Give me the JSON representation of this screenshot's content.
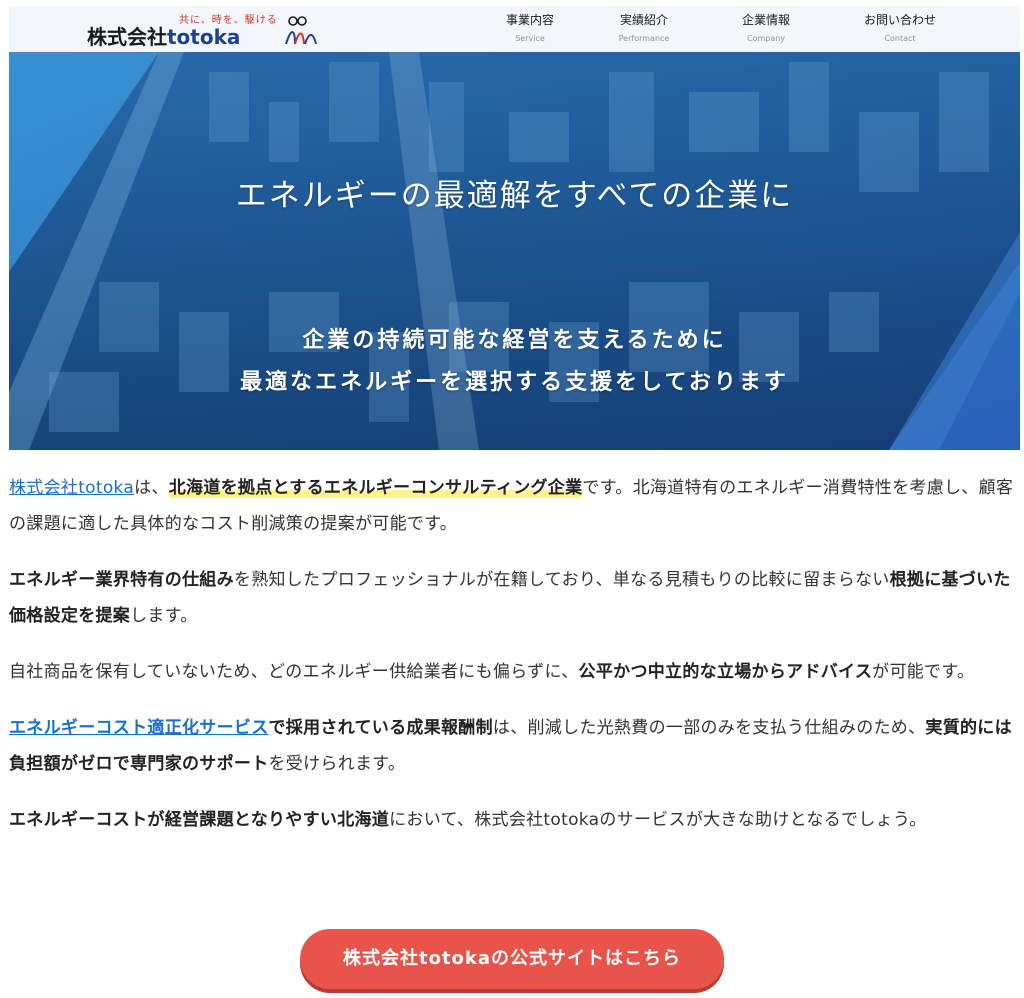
{
  "header": {
    "logo_tagline": "共に、時を、駆ける",
    "logo_name_jp": "株式会社",
    "logo_name_latin": "totoka",
    "nav": [
      {
        "label": "事業内容",
        "sub": "Service"
      },
      {
        "label": "実績紹介",
        "sub": "Performance"
      },
      {
        "label": "企業情報",
        "sub": "Company"
      },
      {
        "label": "お問い合わせ",
        "sub": "Contact"
      }
    ]
  },
  "hero": {
    "title": "エネルギーの最適解をすべての企業に",
    "sub_line1": "企業の持続可能な経営を支えるために",
    "sub_line2": "最適なエネルギーを選択する支援をしております"
  },
  "body": {
    "p1": {
      "link": "株式会社totoka",
      "t1": "は、",
      "highlight": "北海道を拠点とするエネルギーコンサルティング企業",
      "t2": "です。北海道特有のエネルギー消費特性を考慮し、顧客の課題に適した具体的なコスト削減策の提案が可能です。"
    },
    "p2": {
      "b1": "エネルギー業界特有の仕組み",
      "t1": "を熟知したプロフェッショナルが在籍しており、単なる見積もりの比較に留まらない",
      "b2": "根拠に基づいた価格設定を提案",
      "t2": "します。"
    },
    "p3": {
      "t1": "自社商品を保有していないため、どのエネルギー供給業者にも偏らずに、",
      "b1": "公平かつ中立的な立場からアドバイス",
      "t2": "が可能です。"
    },
    "p4": {
      "link": "エネルギーコスト適正化サービス",
      "b1": "で採用されている成果報酬制",
      "t1": "は、削減した光熱費の一部のみを支払う仕組みのため、",
      "b2": "実質的には負担額がゼロで専門家のサポート",
      "t2": "を受けられます。"
    },
    "p5": {
      "b1": "エネルギーコストが経営課題となりやすい北海道",
      "t1": "において、株式会社totokaのサービスが大きな助けとなるでしょう。"
    }
  },
  "cta": {
    "label": "株式会社totokaの公式サイトはこちら"
  },
  "colors": {
    "accent_blue": "#1a6fc9",
    "cta_red": "#e8544a",
    "highlight_yellow": "#fff38a",
    "header_bg": "#f3f6fb"
  }
}
